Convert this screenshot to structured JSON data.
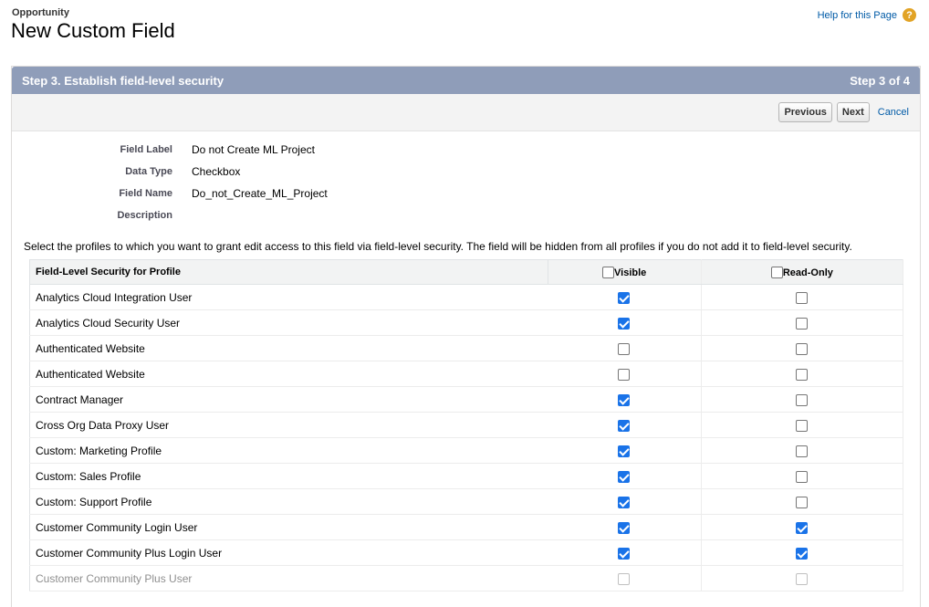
{
  "header": {
    "object_name": "Opportunity",
    "page_title": "New Custom Field",
    "help_link": "Help for this Page",
    "help_icon": "question-icon",
    "help_icon_glyph": "?"
  },
  "step": {
    "title": "Step 3. Establish field-level security",
    "counter": "Step 3 of 4"
  },
  "buttons": {
    "previous": "Previous",
    "next": "Next",
    "cancel": "Cancel"
  },
  "field_details": [
    {
      "label": "Field Label",
      "value": "Do not Create ML Project"
    },
    {
      "label": "Data Type",
      "value": "Checkbox"
    },
    {
      "label": "Field Name",
      "value": "Do_not_Create_ML_Project"
    },
    {
      "label": "Description",
      "value": ""
    }
  ],
  "instruction": "Select the profiles to which you want to grant edit access to this field via field-level security. The field will be hidden from all profiles if you do not add it to field-level security.",
  "table": {
    "headers": {
      "profile": "Field-Level Security for Profile",
      "visible": "Visible",
      "read_only": "Read-Only"
    },
    "header_checks": {
      "visible": false,
      "read_only": false
    },
    "rows": [
      {
        "profile": "Analytics Cloud Integration User",
        "visible": true,
        "read_only": false
      },
      {
        "profile": "Analytics Cloud Security User",
        "visible": true,
        "read_only": false
      },
      {
        "profile": "Authenticated Website",
        "visible": false,
        "read_only": false
      },
      {
        "profile": "Authenticated Website",
        "visible": false,
        "read_only": false
      },
      {
        "profile": "Contract Manager",
        "visible": true,
        "read_only": false
      },
      {
        "profile": "Cross Org Data Proxy User",
        "visible": true,
        "read_only": false
      },
      {
        "profile": "Custom: Marketing Profile",
        "visible": true,
        "read_only": false
      },
      {
        "profile": "Custom: Sales Profile",
        "visible": true,
        "read_only": false
      },
      {
        "profile": "Custom: Support Profile",
        "visible": true,
        "read_only": false
      },
      {
        "profile": "Customer Community Login User",
        "visible": true,
        "read_only": true
      },
      {
        "profile": "Customer Community Plus Login User",
        "visible": true,
        "read_only": true
      },
      {
        "profile": "Customer Community Plus User",
        "visible": false,
        "read_only": false
      }
    ]
  },
  "colors": {
    "step_bar": "#8f9db9",
    "link": "#015ba7",
    "checkbox_checked": "#1a73e8",
    "help_icon": "#e2a325"
  }
}
